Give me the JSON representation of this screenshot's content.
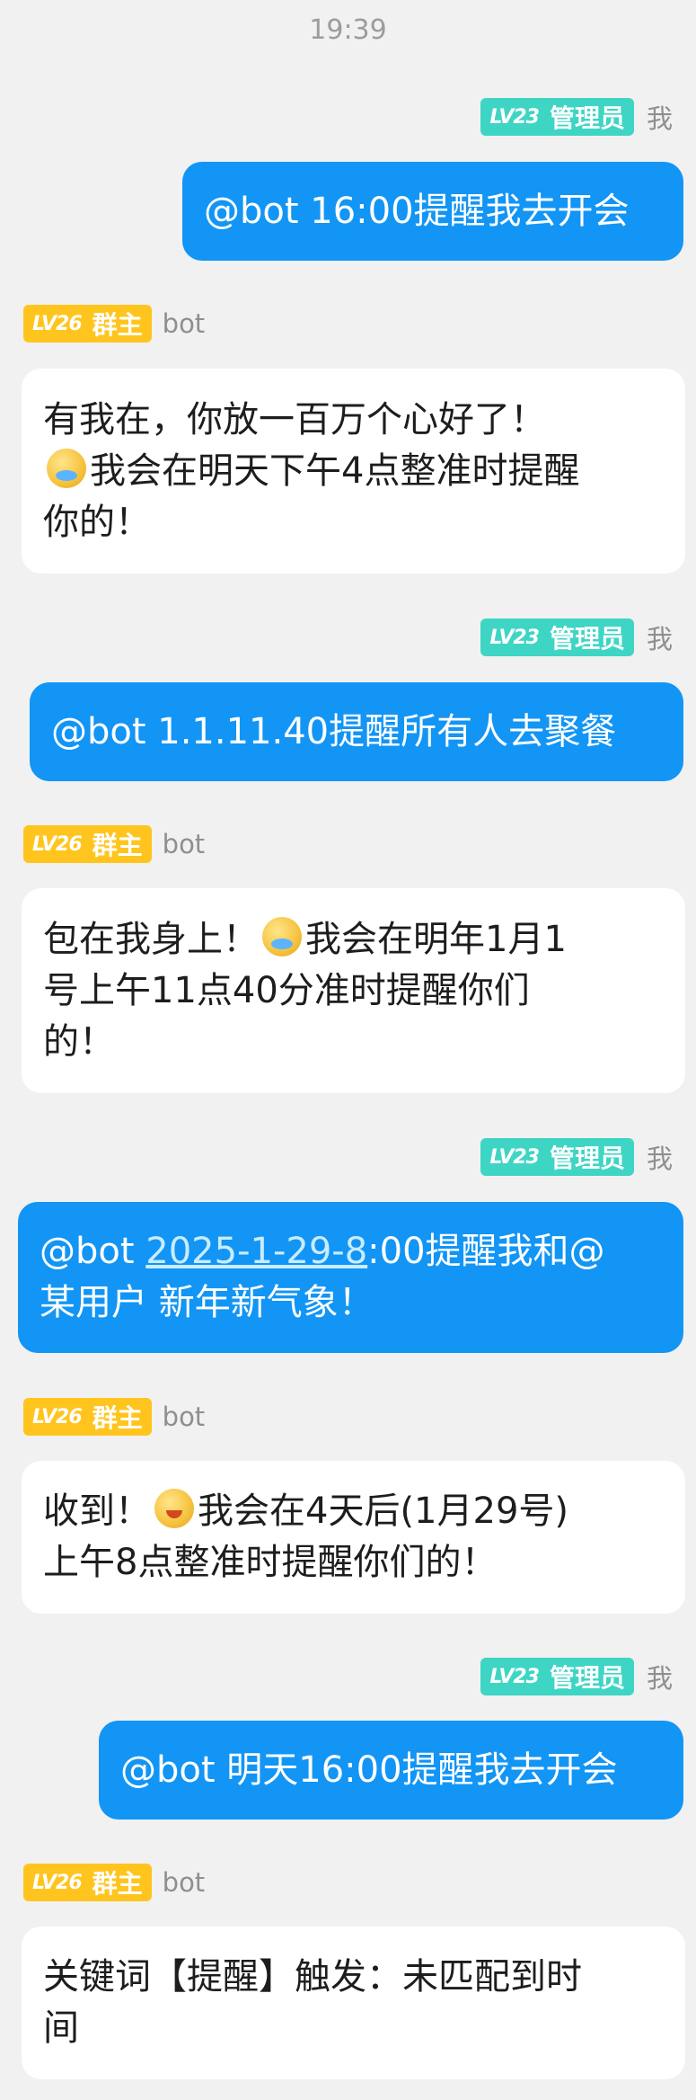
{
  "status_bar": {
    "time": "19:39"
  },
  "messages": [
    {
      "sender": "我",
      "level": "LV23",
      "role": "管理员",
      "direction": "out",
      "segments": [
        {
          "text": "@bot 16:00提醒我去开会"
        }
      ]
    },
    {
      "sender": "bot",
      "level": "LV26",
      "role": "群主",
      "direction": "in",
      "segments": [
        {
          "text": "有我在，你放一百万个心好了！"
        },
        {
          "br": true
        },
        {
          "emoji": "fish-face-emoji"
        },
        {
          "text": "我会在明天下午4点整准时提醒"
        },
        {
          "br": true
        },
        {
          "text": "你的！"
        }
      ]
    },
    {
      "sender": "我",
      "level": "LV23",
      "role": "管理员",
      "direction": "out",
      "segments": [
        {
          "text": "@bot 1.1.11.40提醒所有人去聚餐"
        }
      ]
    },
    {
      "sender": "bot",
      "level": "LV26",
      "role": "群主",
      "direction": "in",
      "segments": [
        {
          "text": "包在我身上！"
        },
        {
          "emoji": "fish-face-emoji"
        },
        {
          "text": "我会在明年1月1"
        },
        {
          "br": true
        },
        {
          "text": "号上午11点40分准时提醒你们"
        },
        {
          "br": true
        },
        {
          "text": "的！"
        }
      ]
    },
    {
      "sender": "我",
      "level": "LV23",
      "role": "管理员",
      "direction": "out",
      "segments": [
        {
          "text": "@bot "
        },
        {
          "link": "2025-1-29-8"
        },
        {
          "text": ":00提醒我和@"
        },
        {
          "br": true
        },
        {
          "text": "某用户 新年新气象！"
        }
      ]
    },
    {
      "sender": "bot",
      "level": "LV26",
      "role": "群主",
      "direction": "in",
      "segments": [
        {
          "text": "收到！"
        },
        {
          "emoji": "happy-face-emoji"
        },
        {
          "text": "我会在4天后(1月29号)"
        },
        {
          "br": true
        },
        {
          "text": "上午8点整准时提醒你们的！"
        }
      ]
    },
    {
      "sender": "我",
      "level": "LV23",
      "role": "管理员",
      "direction": "out",
      "segments": [
        {
          "text": "@bot 明天16:00提醒我去开会"
        }
      ]
    },
    {
      "sender": "bot",
      "level": "LV26",
      "role": "群主",
      "direction": "in",
      "segments": [
        {
          "text": "关键词【提醒】触发：未匹配到时"
        },
        {
          "br": true
        },
        {
          "text": "间"
        }
      ]
    }
  ]
}
